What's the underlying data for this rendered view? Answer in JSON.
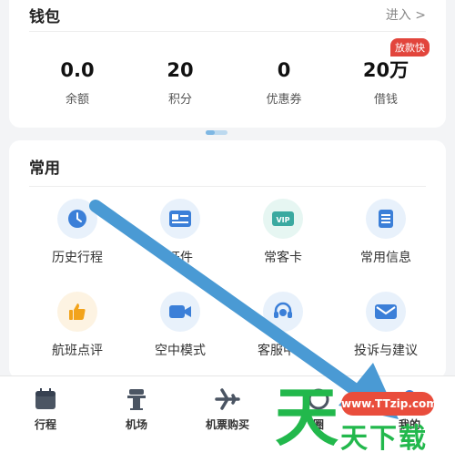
{
  "wallet": {
    "title": "钱包",
    "enter_label": "进入 >",
    "badge": "放款快",
    "stats": [
      {
        "value": "0.0",
        "label": "余额"
      },
      {
        "value": "20",
        "label": "积分"
      },
      {
        "value": "0",
        "label": "优惠券"
      },
      {
        "value": "20万",
        "label": "借钱"
      }
    ]
  },
  "common": {
    "title": "常用",
    "items": [
      {
        "label": "历史行程",
        "icon": "clock-icon"
      },
      {
        "label": "证件",
        "icon": "id-card-icon"
      },
      {
        "label": "常客卡",
        "icon": "vip-card-icon"
      },
      {
        "label": "常用信息",
        "icon": "document-icon"
      },
      {
        "label": "航班点评",
        "icon": "thumbs-up-icon"
      },
      {
        "label": "空中模式",
        "icon": "video-camera-icon"
      },
      {
        "label": "客服中心",
        "icon": "headset-icon"
      },
      {
        "label": "投诉与建议",
        "icon": "envelope-icon"
      }
    ]
  },
  "tabbar": {
    "tabs": [
      {
        "label": "行程",
        "icon": "calendar-icon"
      },
      {
        "label": "机场",
        "icon": "control-tower-icon"
      },
      {
        "label": "机票购买",
        "icon": "airplane-icon"
      },
      {
        "label": "圈",
        "icon": "circle-icon"
      },
      {
        "label": "我的",
        "icon": "profile-icon"
      }
    ]
  },
  "watermark": {
    "url": "www.TTzip.com",
    "big_char": "天",
    "text": "天下载"
  },
  "colors": {
    "accent": "#3b8be0",
    "badge": "#e2453c",
    "watermark_green": "#22b84c"
  }
}
